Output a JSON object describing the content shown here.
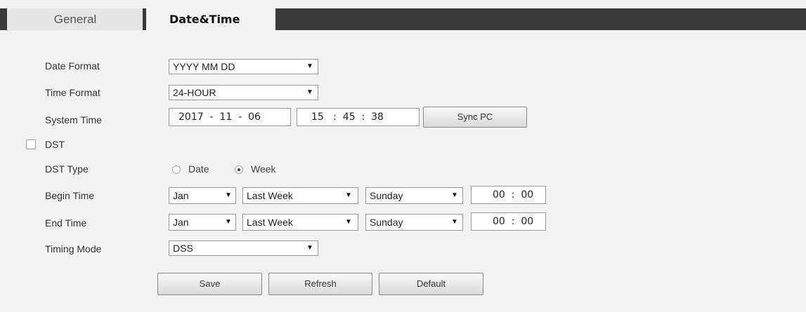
{
  "tabs": {
    "general": "General",
    "active": "Date&Time"
  },
  "labels": {
    "date_format": "Date Format",
    "time_format": "Time Format",
    "system_time": "System Time",
    "dst": "DST",
    "dst_type": "DST Type",
    "begin_time": "Begin Time",
    "end_time": "End Time",
    "timing_mode": "Timing Mode"
  },
  "date_format": {
    "value": "YYYY MM DD"
  },
  "time_format": {
    "value": "24-HOUR"
  },
  "system_time": {
    "date": "2017  -  11  -  06",
    "time": "15   :  45  :  38",
    "sync_label": "Sync PC"
  },
  "dst": {
    "checked": false
  },
  "dst_type": {
    "option_date": "Date",
    "option_week": "Week",
    "selected": "Week"
  },
  "begin_time": {
    "month": "Jan",
    "week": "Last Week",
    "day": "Sunday",
    "time": "00  :  00"
  },
  "end_time": {
    "month": "Jan",
    "week": "Last Week",
    "day": "Sunday",
    "time": "00  :  00"
  },
  "timing_mode": {
    "value": "DSS"
  },
  "buttons": {
    "save": "Save",
    "refresh": "Refresh",
    "default": "Default"
  },
  "arrow_glyph": "▼"
}
